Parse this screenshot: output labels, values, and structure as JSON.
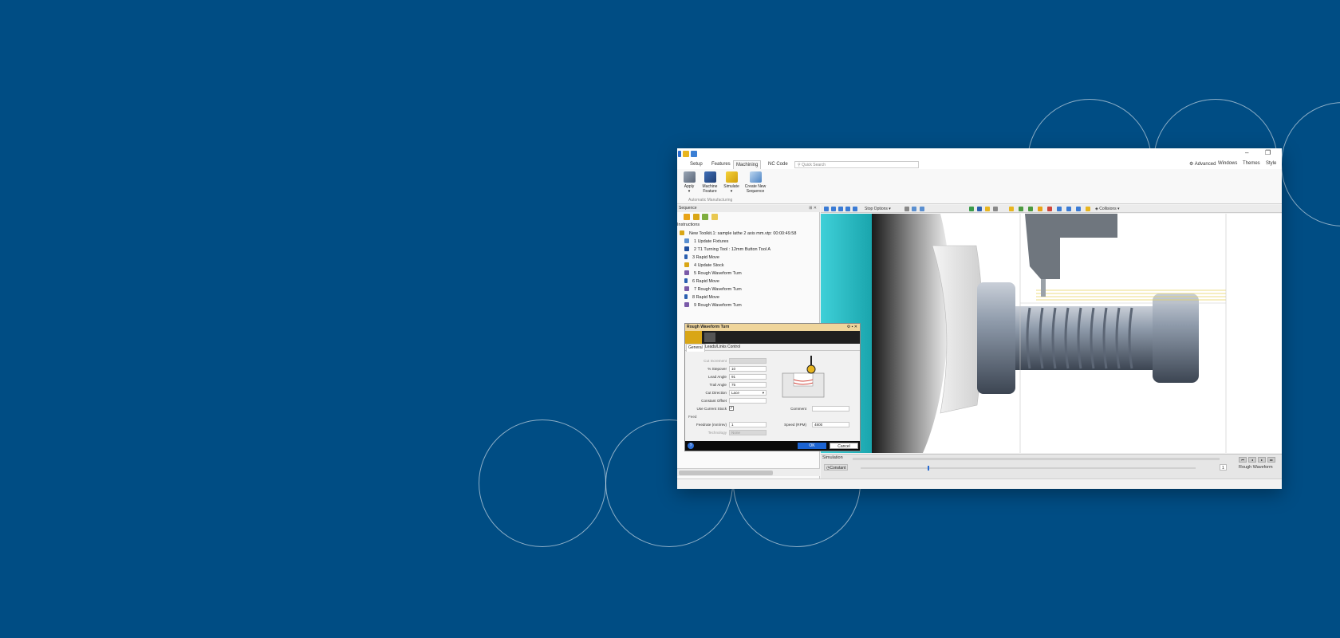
{
  "colors": {
    "background": "#004d84",
    "accent_blue": "#1b63d2",
    "highlight_yellow": "#d9a616",
    "chuck_cyan": "#3fd0d8",
    "part_steel": "#8f9bab"
  },
  "tabs": [
    "Setup",
    "Features",
    "Machining",
    "NC Code"
  ],
  "active_tab": "Machining",
  "search": {
    "placeholder": "Quick Search"
  },
  "menu_right": [
    "Advanced",
    "Windows",
    "Themes",
    "Style"
  ],
  "ribbon": {
    "buttons": [
      {
        "label": "Apply",
        "icon": "apply-icon"
      },
      {
        "label": "Machine Feature",
        "icon": "machine-feature-icon"
      },
      {
        "label": "Simulate",
        "icon": "simulate-icon"
      },
      {
        "label": "Create New Sequence",
        "icon": "create-sequence-icon"
      }
    ],
    "group_label": "Automatic Manufacturing"
  },
  "sequence_pane": {
    "title": "Sequence",
    "header": "Instructions",
    "root": "New Toolkit.1: sample lathe 2 axis mm.vtp: 00:00:49.58",
    "items": [
      "1 Update Fixtures",
      "2 T1 Turning Tool : 12mm Button Tool A",
      "3 Rapid Move",
      "4 Update Stock",
      "5 Rough Waveform Turn",
      "6 Rapid Move",
      "7 Rough Waveform Turn",
      "8 Rapid Move",
      "9 Rough Waveform Turn"
    ]
  },
  "dialog": {
    "title": "Rough Waveform Turn",
    "tabs": [
      "General",
      "Leads/Links",
      "Control"
    ],
    "section_cut": "Cut Increment",
    "fields": {
      "stepover": {
        "label": "% Stepover",
        "value": "10"
      },
      "lead_angle": {
        "label": "Lead Angle",
        "value": "91"
      },
      "trail_angle": {
        "label": "Trail Angle",
        "value": "75"
      },
      "cut_direction": {
        "label": "Cut Direction",
        "value": "Lace"
      },
      "constant_offset": {
        "label": "Constant Offset",
        "value": ""
      },
      "use_current_stock": {
        "label": "Use Current Stock",
        "checked": true
      },
      "comment": {
        "label": "Comment",
        "value": ""
      }
    },
    "section_feed": "Feed",
    "feedrate": {
      "label": "Feedrate (mm/rev)",
      "value": "1"
    },
    "speed": {
      "label": "Speed (RPM)",
      "value": "4800"
    },
    "technology": {
      "label": "Technology",
      "value": "None"
    },
    "ok_label": "OK",
    "cancel_label": "Cancel"
  },
  "view_toolbar": {
    "stop_options": "Stop Options",
    "collisions": "Collisions"
  },
  "simulation": {
    "title": "Simulation",
    "constant_label": "Constant",
    "step_value": "1",
    "current_op": "Rough Waveform",
    "slider_position": 0.2
  }
}
